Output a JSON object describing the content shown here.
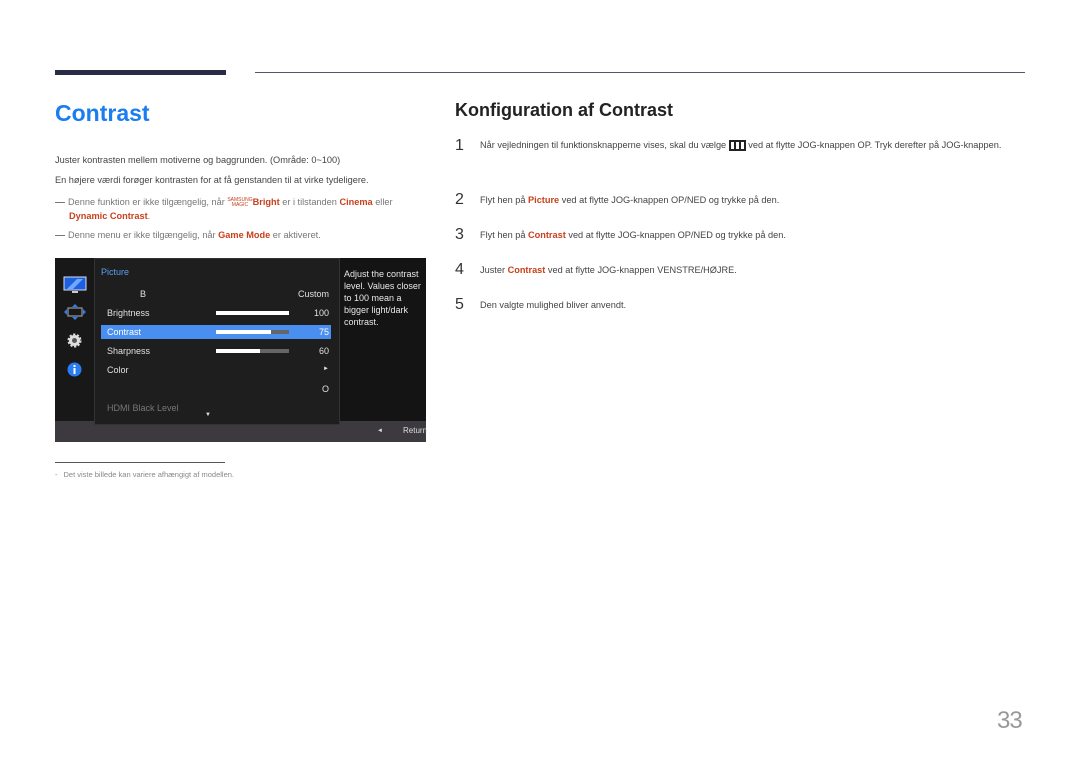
{
  "left": {
    "title": "Contrast",
    "para1": "Juster kontrasten mellem motiverne og baggrunden. (Område: 0~100)",
    "para2": "En højere værdi forøger kontrasten for at få genstanden til at virke tydeligere.",
    "note1": {
      "pre": "Denne funktion er ikke tilgængelig, når ",
      "magic_top": "SAMSUNG",
      "magic_bottom": "MAGIC",
      "bright": "Bright",
      "mid": " er i tilstanden ",
      "cinema": "Cinema",
      "post": " eller",
      "dynamic": "Dynamic Contrast",
      "end": "."
    },
    "note2": {
      "pre": "Denne menu er ikke tilgængelig, når ",
      "game": "Game Mode",
      "post": " er aktiveret."
    }
  },
  "osd": {
    "header": "Picture",
    "row0_label": "B",
    "row0_value": "Custom",
    "items": [
      {
        "label": "Brightness",
        "value": "100",
        "level": 1.0
      },
      {
        "label": "Contrast",
        "value": "75",
        "level": 0.75
      },
      {
        "label": "Sharpness",
        "value": "60",
        "level": 0.6
      },
      {
        "label": "Color",
        "value": "►"
      }
    ],
    "row5_value": "O",
    "hdmi": "HDMI Black Level",
    "help": "Adjust the contrast level. Values closer to 100 mean a bigger light/dark contrast.",
    "return": "Return",
    "accent": "#4a8ef0"
  },
  "right": {
    "title": "Konfiguration af Contrast",
    "steps": [
      {
        "num": "1",
        "pre": "Når vejledningen til funktionsknapperne vises, skal du vælge ",
        "post": " ved at flytte JOG-knappen OP. Tryk derefter på JOG-knappen."
      },
      {
        "num": "2",
        "pre": "Flyt hen på ",
        "hl": "Picture",
        "post": " ved at flytte JOG-knappen OP/NED og trykke på den."
      },
      {
        "num": "3",
        "pre": "Flyt hen på ",
        "hl": "Contrast",
        "post": " ved at flytte JOG-knappen OP/NED og trykke på den."
      },
      {
        "num": "4",
        "pre": "Juster ",
        "hl": "Contrast",
        "post": " ved at flytte JOG-knappen VENSTRE/HØJRE."
      },
      {
        "num": "5",
        "pre": "Den valgte mulighed bliver anvendt.",
        "post": ""
      }
    ]
  },
  "footnote": "Det viste billede kan variere afhængigt af modellen.",
  "page_number": "33"
}
